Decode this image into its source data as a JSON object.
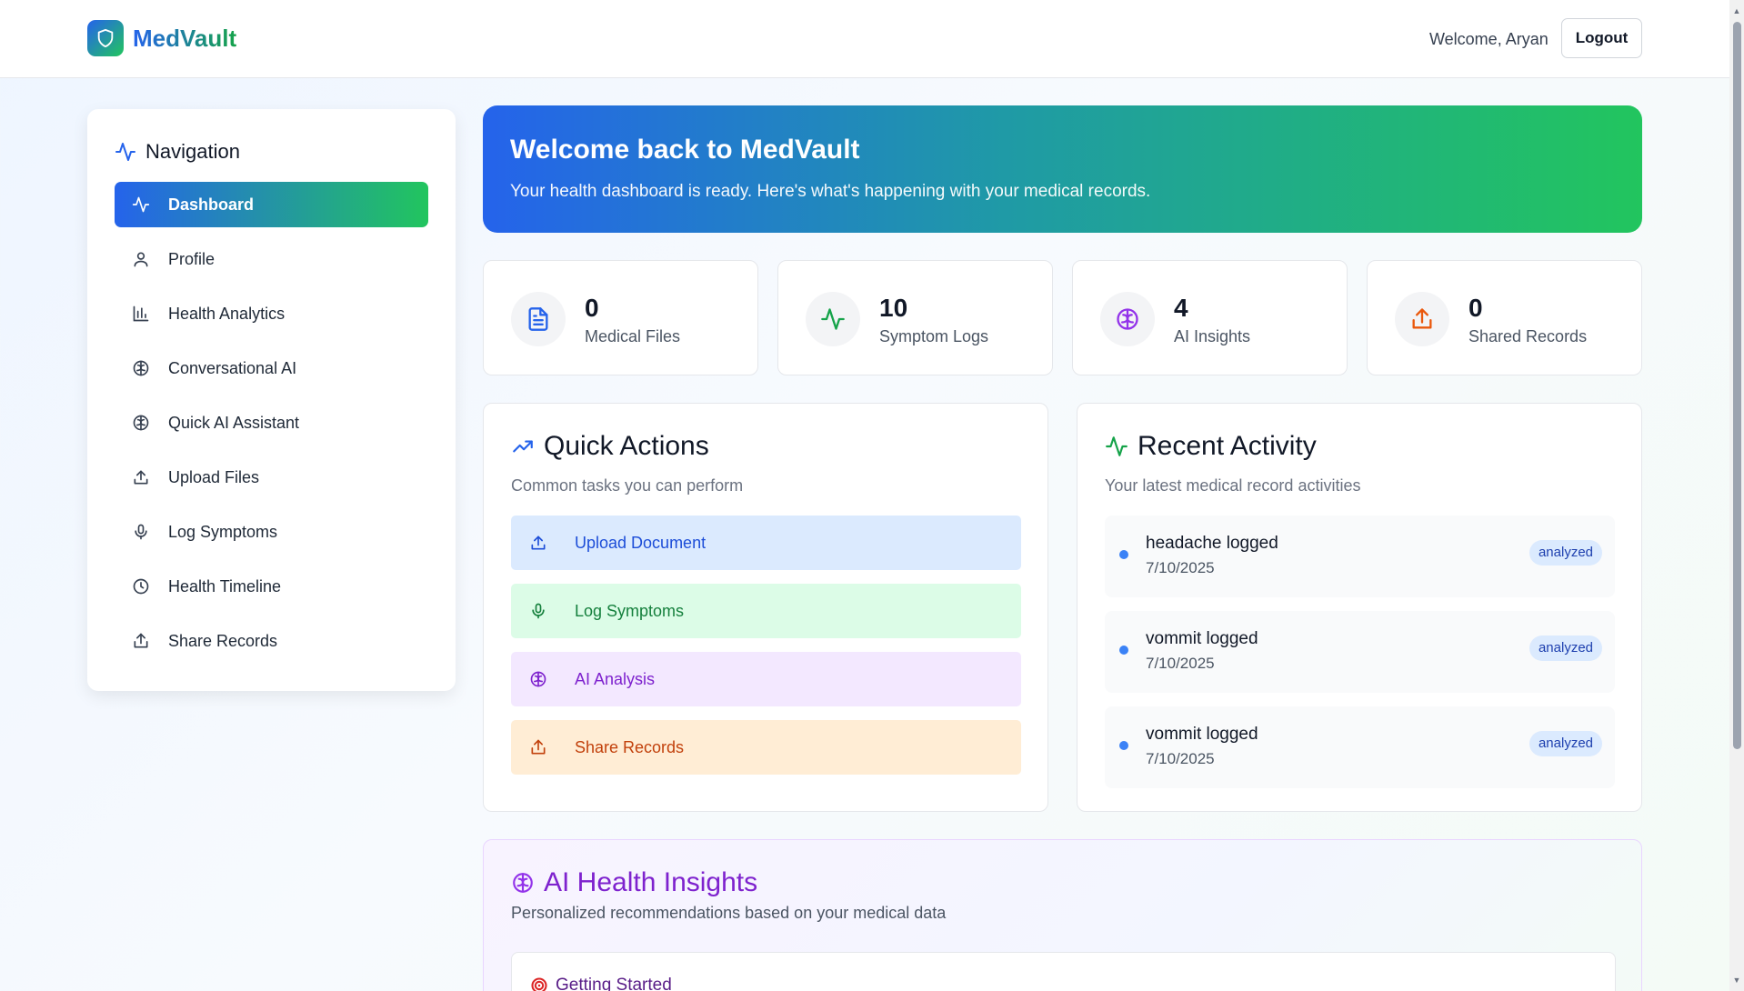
{
  "header": {
    "brand": "MedVault",
    "welcome": "Welcome, Aryan",
    "logout_label": "Logout"
  },
  "sidebar": {
    "title": "Navigation",
    "items": [
      {
        "label": "Dashboard",
        "icon": "activity-icon",
        "active": true
      },
      {
        "label": "Profile",
        "icon": "user-icon"
      },
      {
        "label": "Health Analytics",
        "icon": "bar-chart-icon"
      },
      {
        "label": "Conversational AI",
        "icon": "brain-icon"
      },
      {
        "label": "Quick AI Assistant",
        "icon": "brain-icon"
      },
      {
        "label": "Upload Files",
        "icon": "upload-icon"
      },
      {
        "label": "Log Symptoms",
        "icon": "mic-icon"
      },
      {
        "label": "Health Timeline",
        "icon": "clock-icon"
      },
      {
        "label": "Share Records",
        "icon": "share-icon"
      }
    ]
  },
  "hero": {
    "title": "Welcome back to MedVault",
    "subtitle": "Your health dashboard is ready. Here's what's happening with your medical records."
  },
  "stats": [
    {
      "value": "0",
      "label": "Medical Files",
      "icon": "file-icon",
      "color": "#2563eb"
    },
    {
      "value": "10",
      "label": "Symptom Logs",
      "icon": "activity-icon",
      "color": "#16a34a"
    },
    {
      "value": "4",
      "label": "AI Insights",
      "icon": "brain-icon",
      "color": "#9333ea"
    },
    {
      "value": "0",
      "label": "Shared Records",
      "icon": "share-icon",
      "color": "#ea580c"
    }
  ],
  "quick_actions": {
    "title": "Quick Actions",
    "subtitle": "Common tasks you can perform",
    "items": [
      {
        "label": "Upload Document",
        "icon": "upload-icon"
      },
      {
        "label": "Log Symptoms",
        "icon": "mic-icon"
      },
      {
        "label": "AI Analysis",
        "icon": "brain-icon"
      },
      {
        "label": "Share Records",
        "icon": "share-icon"
      }
    ]
  },
  "recent_activity": {
    "title": "Recent Activity",
    "subtitle": "Your latest medical record activities",
    "items": [
      {
        "title": "headache logged",
        "date": "7/10/2025",
        "status": "analyzed"
      },
      {
        "title": "vommit logged",
        "date": "7/10/2025",
        "status": "analyzed"
      },
      {
        "title": "vommit logged",
        "date": "7/10/2025",
        "status": "analyzed"
      }
    ]
  },
  "insights": {
    "title": "AI Health Insights",
    "subtitle": "Personalized recommendations based on your medical data",
    "card_title": "Getting Started"
  },
  "colors": {
    "primary": "#2563eb",
    "accent": "#22c55e",
    "purple": "#7e22ce"
  }
}
